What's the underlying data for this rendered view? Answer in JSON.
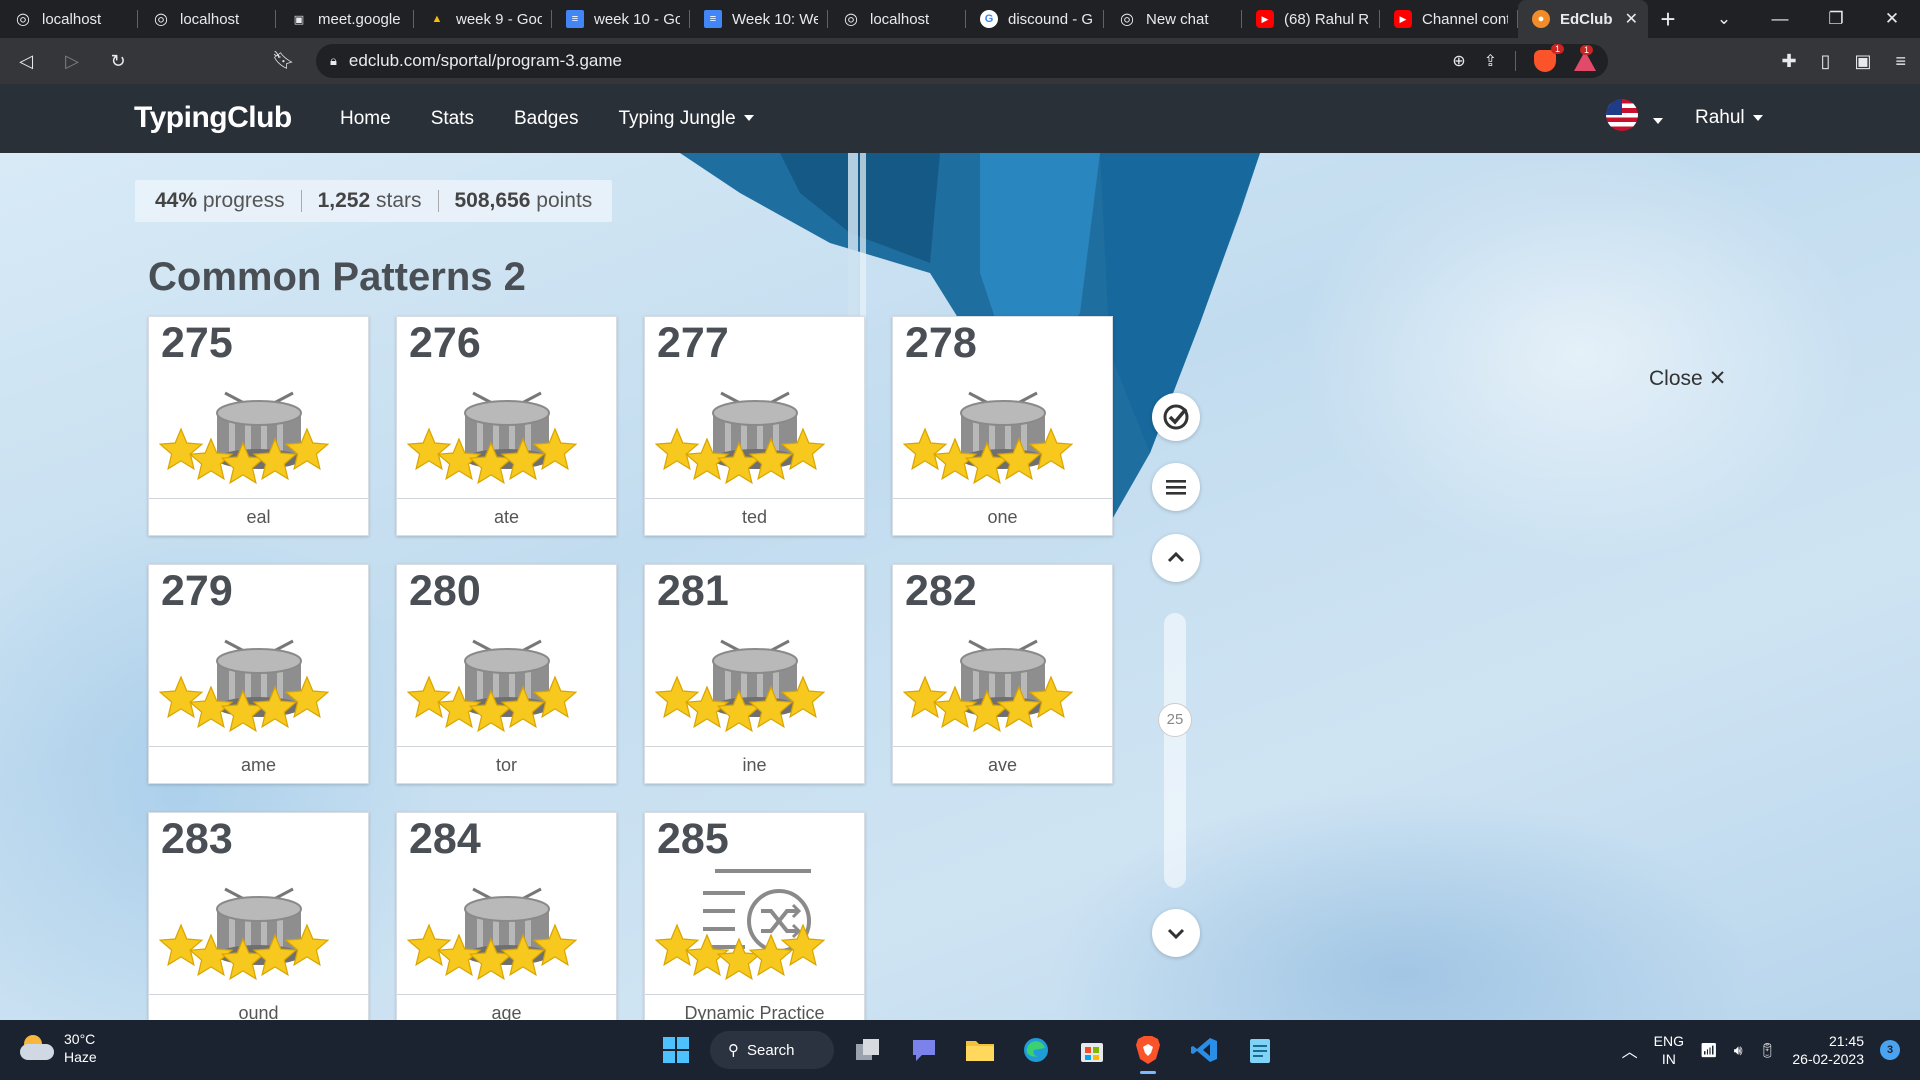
{
  "browser": {
    "tabs": [
      {
        "label": "localhost",
        "icon": "globe-icon",
        "color": "#5f6368"
      },
      {
        "label": "localhost",
        "icon": "globe-icon",
        "color": "#5f6368"
      },
      {
        "label": "meet.google",
        "icon": "meet-icon",
        "color": "#5f6368"
      },
      {
        "label": "week 9 - Goo",
        "icon": "drive-icon",
        "color": "#1fa463"
      },
      {
        "label": "week 10 - Go",
        "icon": "docs-icon",
        "color": "#4285f4"
      },
      {
        "label": "Week 10: We",
        "icon": "docs-icon",
        "color": "#4285f4"
      },
      {
        "label": "localhost",
        "icon": "globe-icon",
        "color": "#5f6368"
      },
      {
        "label": "discound - G",
        "icon": "google-icon",
        "color": "#ffffff"
      },
      {
        "label": "New chat",
        "icon": "chatgpt-icon",
        "color": "#74aa9c"
      },
      {
        "label": "(68) Rahul R",
        "icon": "youtube-icon",
        "color": "#ff0000"
      },
      {
        "label": "Channel cont",
        "icon": "youtube-icon",
        "color": "#ff0000"
      }
    ],
    "active_tab": {
      "label": "EdClub",
      "icon": "edclub-icon",
      "color": "#f28c28"
    },
    "new_tab": "+",
    "url": "edclub.com/sportal/program-3.game",
    "shield_badge": "1",
    "rewards_badge": "1"
  },
  "site": {
    "brand": "TypingClub",
    "nav": [
      "Home",
      "Stats",
      "Badges",
      "Typing Jungle"
    ],
    "user": "Rahul"
  },
  "stats": {
    "progress_value": "44%",
    "progress_label": "progress",
    "stars_value": "1,252",
    "stars_label": "stars",
    "points_value": "508,656",
    "points_label": "points"
  },
  "section_title": "Common Patterns 2",
  "lessons": [
    {
      "number": "275",
      "word": "eal",
      "type": "drum",
      "stars": 5
    },
    {
      "number": "276",
      "word": "ate",
      "type": "drum",
      "stars": 5
    },
    {
      "number": "277",
      "word": "ted",
      "type": "drum",
      "stars": 5
    },
    {
      "number": "278",
      "word": "one",
      "type": "drum",
      "stars": 5
    },
    {
      "number": "279",
      "word": "ame",
      "type": "drum",
      "stars": 5
    },
    {
      "number": "280",
      "word": "tor",
      "type": "drum",
      "stars": 5
    },
    {
      "number": "281",
      "word": "ine",
      "type": "drum",
      "stars": 5
    },
    {
      "number": "282",
      "word": "ave",
      "type": "drum",
      "stars": 5
    },
    {
      "number": "283",
      "word": "ound",
      "type": "drum",
      "stars": 5
    },
    {
      "number": "284",
      "word": "age",
      "type": "drum",
      "stars": 5
    },
    {
      "number": "285",
      "word": "Dynamic Practice",
      "type": "shuffle",
      "stars": 5
    }
  ],
  "side_controls": {
    "scroll_position": "25",
    "close_label": "Close",
    "close_symbol": "✕"
  },
  "taskbar": {
    "weather_temp": "30°C",
    "weather_desc": "Haze",
    "search_label": "Search",
    "lang_line1": "ENG",
    "lang_line2": "IN",
    "time": "21:45",
    "date": "26-02-2023",
    "notifications": "3"
  },
  "colors": {
    "nav_bg": "#2a3038",
    "star": "#f7c81e",
    "drum": "#8e8e8e"
  }
}
